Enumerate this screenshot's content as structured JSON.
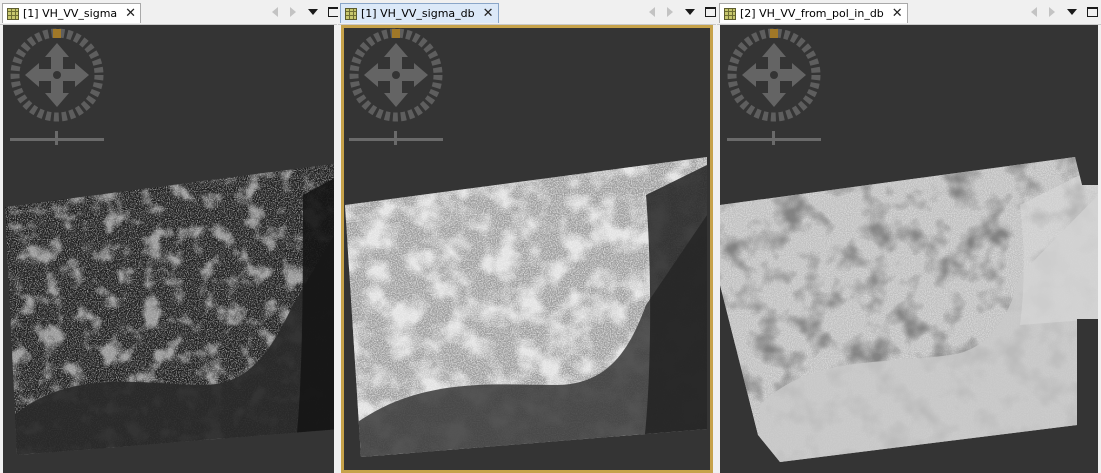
{
  "panes": [
    {
      "tab_label": "[1] VH_VV_sigma",
      "active": false
    },
    {
      "tab_label": "[1] VH_VV_sigma_db",
      "active": true
    },
    {
      "tab_label": "[2] VH_VV_from_pol_in_db",
      "active": false
    }
  ],
  "icons": {
    "tab_image": "image-band-icon",
    "tab_close": "close-icon",
    "scroll_left": "scroll-left-icon",
    "scroll_right": "scroll-right-icon",
    "menu": "chevron-down-icon",
    "maximize": "maximize-icon",
    "navigation": "navigation-control-icon",
    "zoom": "zoom-slider-icon"
  },
  "close_glyph": "✕",
  "colors": {
    "view_background": "#343434",
    "active_border": "#c6a24a",
    "active_tab": "#dce9f8"
  }
}
